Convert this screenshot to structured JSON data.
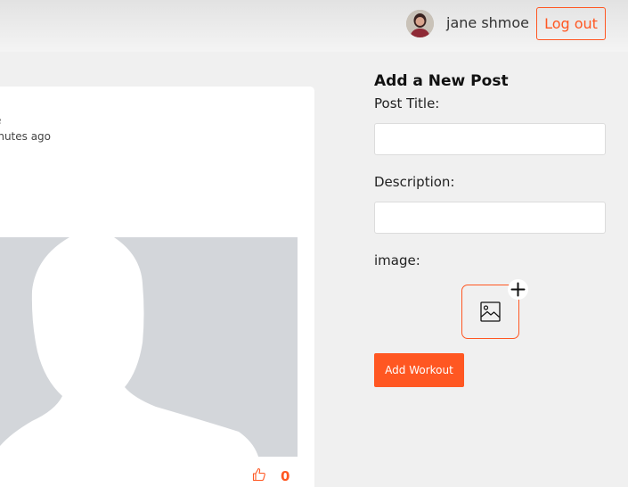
{
  "header": {
    "username": "jane shmoe",
    "logout_label": "Log out",
    "avatar_icon": "user-avatar"
  },
  "post": {
    "author": "e",
    "time": "inutes ago",
    "image_icon": "default-profile-silhouette",
    "like_icon": "thumbs-up-icon",
    "like_count": "0"
  },
  "form": {
    "title": "Add a New Post",
    "title_label": "Post Title:",
    "title_value": "",
    "description_label": "Description:",
    "description_value": "",
    "image_label": "image:",
    "image_picker_icon": "image-icon",
    "add_icon": "plus-icon",
    "submit_label": "Add Workout"
  },
  "colors": {
    "accent": "#ff5722",
    "background": "#f0f0f0",
    "card": "#ffffff",
    "placeholder_image": "#d3d6da"
  }
}
